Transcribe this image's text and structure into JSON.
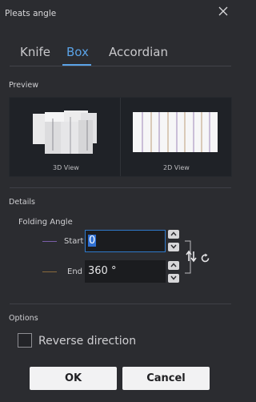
{
  "window": {
    "title": "Pleats angle",
    "close_icon": "close-icon"
  },
  "tabs": [
    {
      "label": "Knife",
      "active": false
    },
    {
      "label": "Box",
      "active": true
    },
    {
      "label": "Accordian",
      "active": false
    }
  ],
  "preview": {
    "section_label": "Preview",
    "view_3d_caption": "3D View",
    "view_2d_caption": "2D View"
  },
  "details": {
    "section_label": "Details",
    "folding_angle_label": "Folding Angle",
    "start": {
      "label": "Start",
      "value": "0",
      "line_color": "#7a5ea8"
    },
    "end": {
      "label": "End",
      "value": "360 °",
      "line_color": "#8a6a3c"
    },
    "swap_icon": "swap-vertical-icon",
    "reset_icon": "reset-icon"
  },
  "options": {
    "section_label": "Options",
    "reverse_direction_label": "Reverse direction",
    "reverse_direction_checked": false
  },
  "buttons": {
    "ok": "OK",
    "cancel": "Cancel"
  },
  "colors": {
    "accent": "#5aa2e6",
    "background": "#2b2c30",
    "focus_border": "#2f79c9"
  }
}
